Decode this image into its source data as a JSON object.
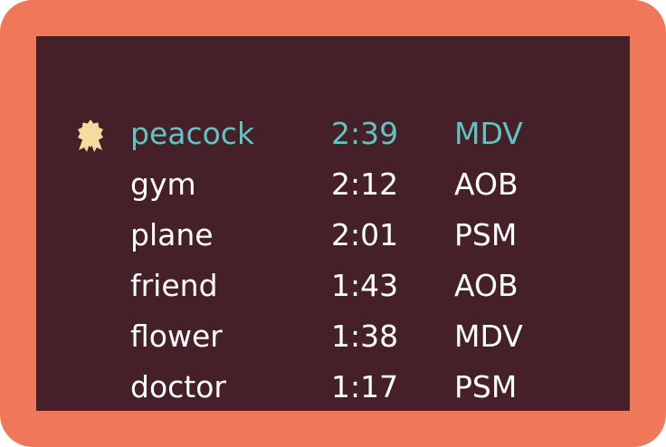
{
  "leaderboard": {
    "rows": [
      {
        "word": "peacock",
        "time": "2:39",
        "team": "MDV",
        "highlighted": true,
        "badge": "medal-icon"
      },
      {
        "word": "gym",
        "time": "2:12",
        "team": "AOB",
        "highlighted": false
      },
      {
        "word": "plane",
        "time": "2:01",
        "team": "PSM",
        "highlighted": false
      },
      {
        "word": "friend",
        "time": "1:43",
        "team": "AOB",
        "highlighted": false
      },
      {
        "word": "flower",
        "time": "1:38",
        "team": "MDV",
        "highlighted": false
      },
      {
        "word": "doctor",
        "time": "1:17",
        "team": "PSM",
        "highlighted": false
      }
    ]
  },
  "colors": {
    "frame": "#ee7858",
    "panel": "#462029",
    "text": "#ffffff",
    "highlight": "#5fc4c4",
    "medal": "#f6dba0"
  }
}
